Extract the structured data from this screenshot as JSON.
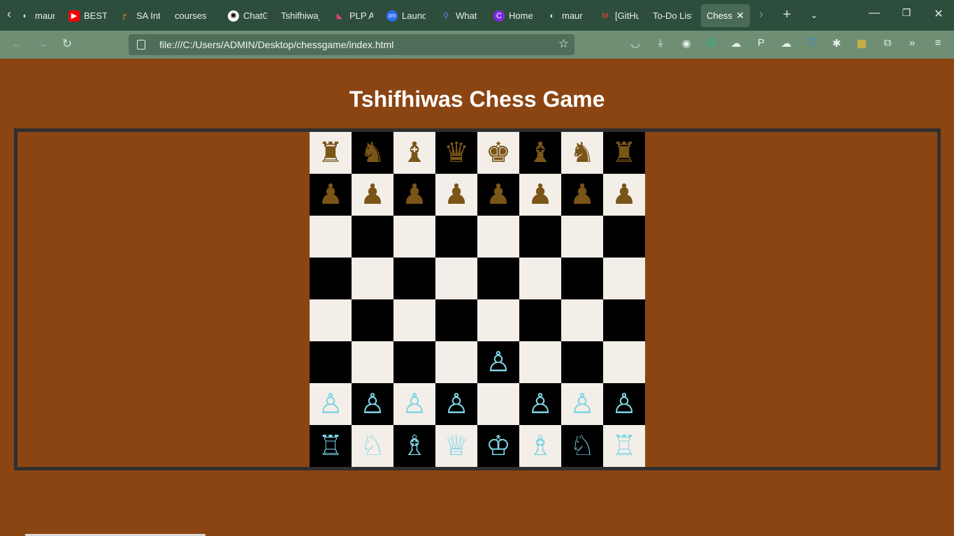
{
  "browser": {
    "tabs": [
      {
        "title": "maur",
        "icon": "github-icon"
      },
      {
        "title": "BEST I",
        "icon": "youtube-icon",
        "color": "#ff0000"
      },
      {
        "title": "SA Int",
        "icon": "graduation-cap-icon"
      },
      {
        "title": "courses",
        "icon": ""
      },
      {
        "title": "ChatG",
        "icon": "openai-icon"
      },
      {
        "title": "Tshifhiwa_",
        "icon": ""
      },
      {
        "title": "PLP A",
        "icon": "plp-icon"
      },
      {
        "title": "Launc",
        "icon": "zoom-icon",
        "icon_text": "zm"
      },
      {
        "title": "What",
        "icon": "search-icon"
      },
      {
        "title": "Home",
        "icon": "canva-icon",
        "icon_text": "C"
      },
      {
        "title": "maur",
        "icon": "github-icon"
      },
      {
        "title": "[GitHu",
        "icon": "gmail-icon"
      },
      {
        "title": "To-Do List",
        "icon": ""
      },
      {
        "title": "Chess G",
        "icon": "",
        "active": true
      }
    ],
    "address_url": "file:///C:/Users/ADMIN/Desktop/chessgame/index.html"
  },
  "page": {
    "title": "Tshifhiwas Chess Game"
  },
  "board": {
    "colors": {
      "light": "#f3efe8",
      "dark": "#000000",
      "black_pieces": "#7a5518",
      "white_pieces": "#7fd4e6"
    },
    "rows": [
      [
        "♜",
        "♞",
        "♝",
        "♛",
        "♚",
        "♝",
        "♞",
        "♜"
      ],
      [
        "♟",
        "♟",
        "♟",
        "♟",
        "♟",
        "♟",
        "♟",
        "♟"
      ],
      [
        "",
        "",
        "",
        "",
        "",
        "",
        "",
        ""
      ],
      [
        "",
        "",
        "",
        "",
        "",
        "",
        "",
        ""
      ],
      [
        "",
        "",
        "",
        "",
        "",
        "",
        "",
        ""
      ],
      [
        "",
        "",
        "",
        "",
        "♙",
        "",
        "",
        ""
      ],
      [
        "♙",
        "♙",
        "♙",
        "♙",
        "",
        "♙",
        "♙",
        "♙"
      ],
      [
        "♖",
        "♘",
        "♗",
        "♕",
        "♔",
        "♗",
        "♘",
        "♖"
      ]
    ]
  }
}
